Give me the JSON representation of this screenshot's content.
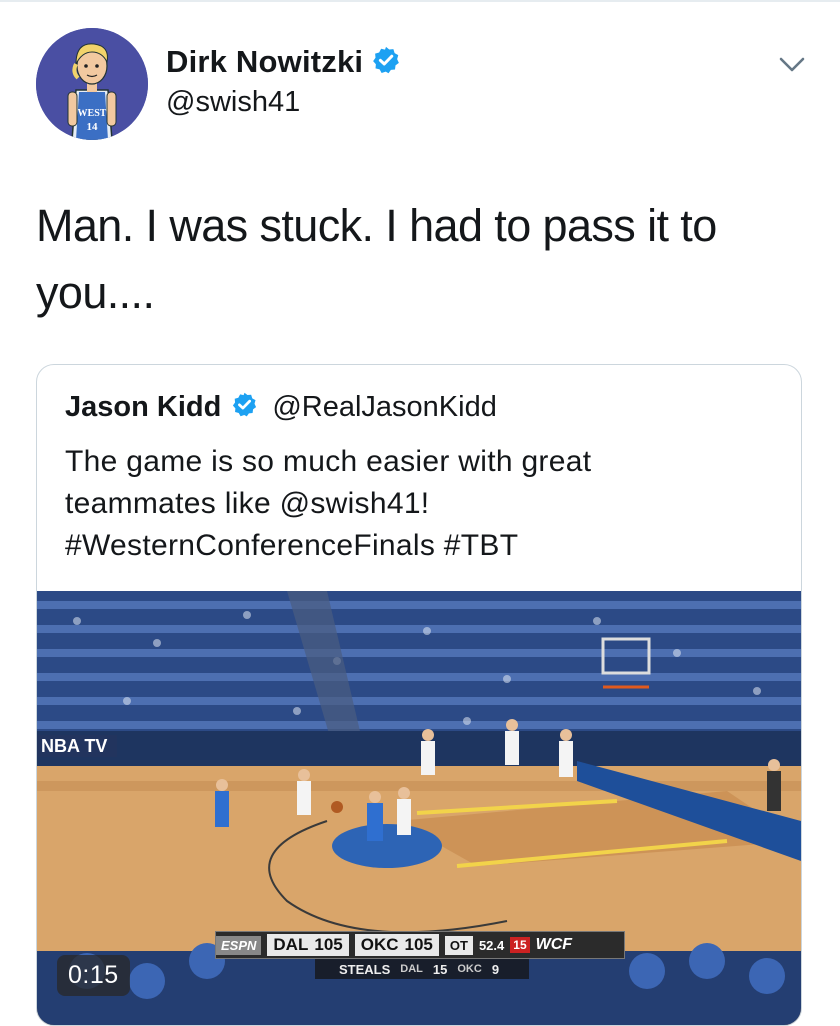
{
  "author": {
    "display_name": "Dirk Nowitzki",
    "handle": "@swish41",
    "verified": true,
    "avatar_jersey_text": "WEST",
    "avatar_jersey_number": "14"
  },
  "tweet": {
    "text": "Man. I was stuck. I had to pass it to you...."
  },
  "quoted_tweet": {
    "display_name": "Jason Kidd",
    "handle": "@RealJasonKidd",
    "verified": true,
    "text_lines": [
      "The game is so much easier with great",
      "teammates like @swish41!",
      "#WesternConferenceFinals #TBT"
    ],
    "video": {
      "duration": "0:15",
      "watermark": "NBA TV",
      "scorebug": {
        "network": "ESPN",
        "away_team": "DAL",
        "away_score": "105",
        "home_team": "OKC",
        "home_score": "105",
        "period": "OT",
        "game_clock": "52.4",
        "shot_clock": "15",
        "series": "WCF",
        "stat_label": "STEALS",
        "stat_away_team": "DAL",
        "stat_away_value": "15",
        "stat_home_team": "OKC",
        "stat_home_value": "9"
      }
    }
  },
  "colors": {
    "verified_badge": "#1da1f2",
    "text_primary": "#14171a",
    "card_border": "#ccd6dd",
    "avatar_bg": "#4a4fa3"
  },
  "icons": {
    "verified": "verified-badge-icon",
    "more": "chevron-down-icon"
  }
}
